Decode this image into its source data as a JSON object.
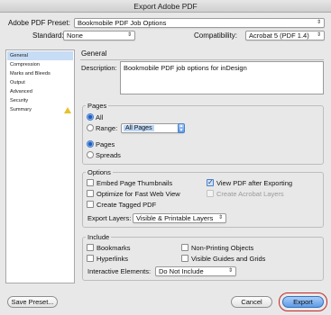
{
  "window": {
    "title": "Export Adobe PDF"
  },
  "top": {
    "preset_label": "Adobe PDF Preset:",
    "preset_value": "Bookmobile PDF Job Options",
    "standard_label": "Standard:",
    "standard_value": "None",
    "compat_label": "Compatibility:",
    "compat_value": "Acrobat 5 (PDF 1.4)"
  },
  "sidebar": {
    "items": [
      {
        "label": "General",
        "active": true
      },
      {
        "label": "Compression"
      },
      {
        "label": "Marks and Bleeds"
      },
      {
        "label": "Output"
      },
      {
        "label": "Advanced"
      },
      {
        "label": "Security"
      },
      {
        "label": "Summary",
        "icon": "warning-icon"
      }
    ]
  },
  "general": {
    "heading": "General",
    "description_label": "Description:",
    "description_value": "Bookmobile PDF job options for inDesign"
  },
  "pages": {
    "group_label": "Pages",
    "all_label": "All",
    "all_selected": true,
    "range_label": "Range:",
    "range_value": "All Pages",
    "range_selected": false,
    "pages_label": "Pages",
    "pages_selected": true,
    "spreads_label": "Spreads",
    "spreads_selected": false
  },
  "options": {
    "group_label": "Options",
    "embed_thumbnails": "Embed Page Thumbnails",
    "embed_thumbnails_checked": false,
    "view_after": "View PDF after Exporting",
    "view_after_checked": true,
    "optimize_web": "Optimize for Fast Web View",
    "optimize_web_checked": false,
    "create_layers": "Create Acrobat Layers",
    "create_layers_checked": false,
    "tagged_pdf": "Create Tagged PDF",
    "tagged_pdf_checked": false,
    "export_layers_label": "Export Layers:",
    "export_layers_value": "Visible & Printable Layers"
  },
  "include": {
    "group_label": "Include",
    "bookmarks": "Bookmarks",
    "bookmarks_checked": false,
    "nonprinting": "Non-Printing Objects",
    "nonprinting_checked": false,
    "hyperlinks": "Hyperlinks",
    "hyperlinks_checked": false,
    "guides_grids": "Visible Guides and Grids",
    "guides_grids_checked": false,
    "interactive_label": "Interactive Elements:",
    "interactive_value": "Do Not Include"
  },
  "footer": {
    "save_preset": "Save Preset...",
    "cancel": "Cancel",
    "export": "Export"
  },
  "colors": {
    "accent": "#5d9ce8",
    "focus_ring": "#c0282a",
    "warning": "#e6c22a"
  }
}
